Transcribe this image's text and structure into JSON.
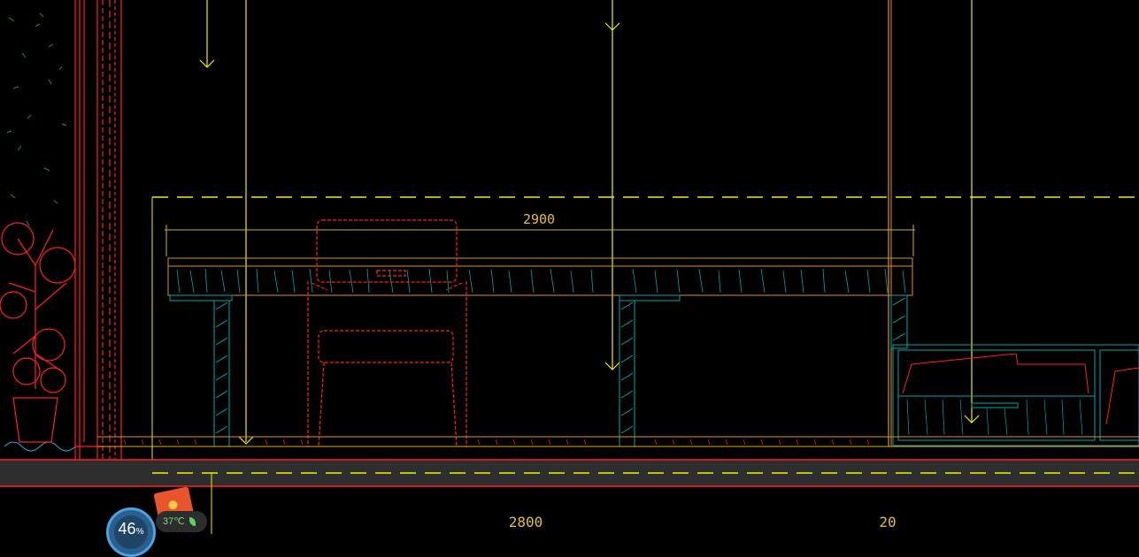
{
  "drawing": {
    "dimension_top": "2900",
    "dimension_bottom": "2800",
    "dimension_right": "20"
  },
  "widget": {
    "cpu_percent": "46",
    "percent_sign": "%",
    "temperature": "37℃"
  },
  "icons": [
    "red-packet-icon",
    "leaf-icon"
  ],
  "colors": {
    "background": "#000000",
    "yellow": "#f0f000",
    "red": "#ff2020",
    "cyan": "#00c8c8",
    "orange": "#e09020"
  }
}
